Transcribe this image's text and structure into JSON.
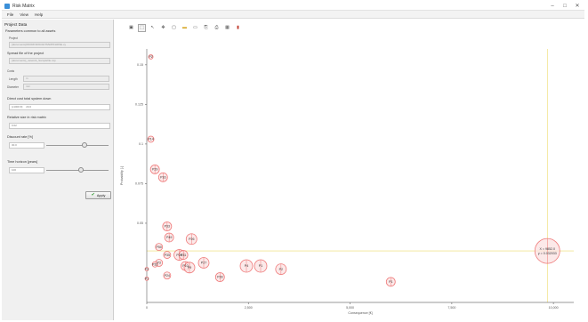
{
  "window": {
    "title": "Risk Matrix",
    "controls": [
      "–",
      "□",
      "✕"
    ]
  },
  "menu": [
    "File",
    "View",
    "Help"
  ],
  "panel": {
    "title": "Project Data",
    "section": "Parameters common to all assets",
    "project_label": "Project",
    "project_value": "[documents]\\WORKSPACE\\TM\\MPFHDSE.xy",
    "spread_label": "Spread file of the project",
    "spread_value": "[documents]_network_Samplefile.xsp",
    "costs_label": "Costs",
    "length_label": "Length",
    "length_value": "m",
    "diameter_label": "Diameter",
    "diameter_value": "mm",
    "direct_cost_label": "Direct cost total system down",
    "direct_cost_unit": "[x1000 €]",
    "direct_cost_value": "20.0",
    "relative_size_label": "Relative size in risk matrix",
    "relative_size_value": "0.02",
    "discount_label": "Discount rate [%]",
    "discount_value": "30.0",
    "discount_fraction": 0.62,
    "horizon_label": "Time horizon [years]",
    "horizon_value": "100",
    "horizon_fraction": 0.55,
    "apply_label": "Apply"
  },
  "toolbar": [
    "save-icon",
    "select-icon",
    "pointer-icon",
    "pan-icon",
    "zoom-box-icon",
    "folder-icon",
    "image-icon",
    "export-icon",
    "print-icon",
    "grid-icon",
    "pdf-icon"
  ],
  "chart_data": {
    "type": "scatter",
    "xlabel": "Consequence [€]",
    "ylabel": "Probability [-]",
    "xlim": [
      0,
      10500
    ],
    "ylim": [
      0,
      0.16
    ],
    "xticks": [
      "0",
      "2,500",
      "5,000",
      "7,500",
      "10,000"
    ],
    "yticks": [
      "0.05",
      "0.075",
      "0.1",
      "0.125",
      "0.15"
    ],
    "bubble_color": "#ef7a7a",
    "highlight": {
      "x": 9850,
      "y": 0.0325,
      "label_x": "X = 9852.0",
      "label_y": "y = 0.032033"
    },
    "points": [
      {
        "label": "P2",
        "x": 100,
        "y": 0.155,
        "r": 2.5
      },
      {
        "label": "P14",
        "x": 100,
        "y": 0.103,
        "r": 3.5
      },
      {
        "label": "P29",
        "x": 200,
        "y": 0.084,
        "r": 5
      },
      {
        "label": "P16",
        "x": 400,
        "y": 0.079,
        "r": 5
      },
      {
        "label": "P33",
        "x": 500,
        "y": 0.048,
        "r": 5
      },
      {
        "label": "P49",
        "x": 550,
        "y": 0.041,
        "r": 5
      },
      {
        "label": "P26",
        "x": 1100,
        "y": 0.04,
        "r": 6
      },
      {
        "label": "P50",
        "x": 300,
        "y": 0.035,
        "r": 4
      },
      {
        "label": "P26",
        "x": 800,
        "y": 0.03,
        "r": 6
      },
      {
        "label": "P31",
        "x": 900,
        "y": 0.03,
        "r": 5
      },
      {
        "label": "P27",
        "x": 1400,
        "y": 0.025,
        "r": 6
      },
      {
        "label": "P35",
        "x": 500,
        "y": 0.03,
        "r": 4
      },
      {
        "label": "P3",
        "x": 300,
        "y": 0.025,
        "r": 4
      },
      {
        "label": "P32",
        "x": 200,
        "y": 0.024,
        "r": 3
      },
      {
        "label": "P10",
        "x": 950,
        "y": 0.023,
        "r": 5
      },
      {
        "label": "P9",
        "x": 1050,
        "y": 0.022,
        "r": 6
      },
      {
        "label": "P4",
        "x": 2450,
        "y": 0.023,
        "r": 7
      },
      {
        "label": "P1",
        "x": 2800,
        "y": 0.023,
        "r": 7
      },
      {
        "label": "P2",
        "x": 3300,
        "y": 0.021,
        "r": 6
      },
      {
        "label": "P28",
        "x": 1800,
        "y": 0.016,
        "r": 5
      },
      {
        "label": "P24",
        "x": 500,
        "y": 0.017,
        "r": 4
      },
      {
        "label": "P1",
        "x": 6000,
        "y": 0.013,
        "r": 5
      },
      {
        "label": "F3",
        "x": 0,
        "y": 0.021,
        "r": 2
      },
      {
        "label": "P1",
        "x": 0,
        "y": 0.015,
        "r": 2
      },
      {
        "label": "",
        "x": 9850,
        "y": 0.0325,
        "r": 14
      }
    ]
  }
}
